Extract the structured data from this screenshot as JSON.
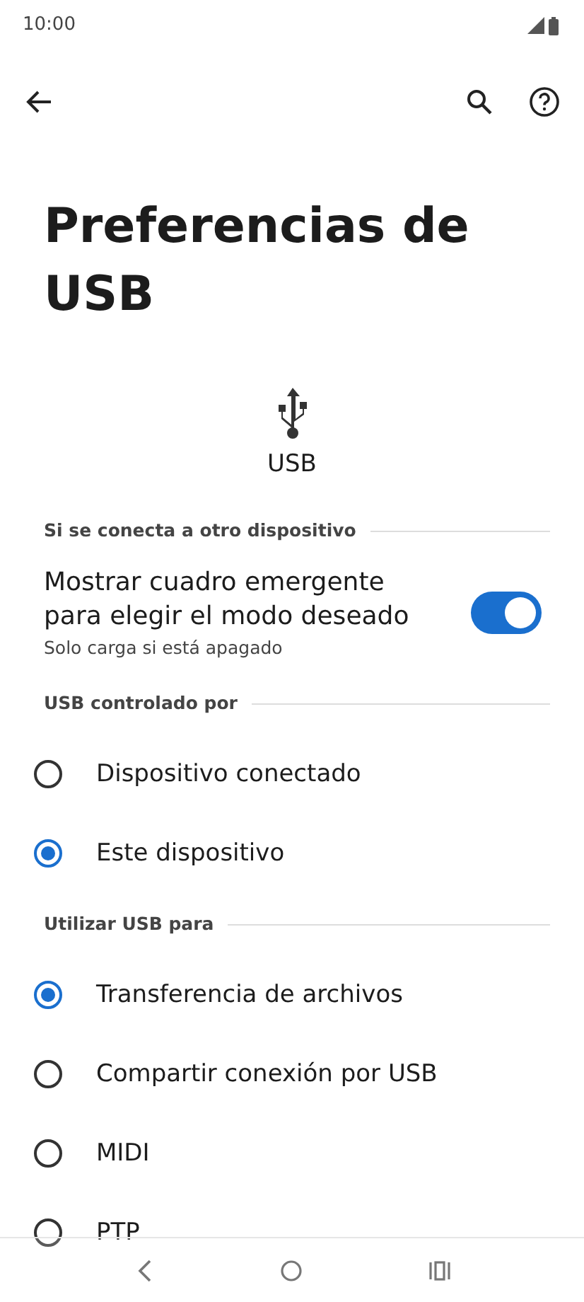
{
  "status_bar": {
    "time": "10:00"
  },
  "title": "Preferencias de USB",
  "device_label": "USB",
  "sections": [
    {
      "header": "Si se conecta a otro dispositivo",
      "items": [
        {
          "kind": "toggle",
          "title": "Mostrar cuadro emergente para elegir el modo deseado",
          "subtitle": "Solo carga si está apagado",
          "on": true
        }
      ]
    },
    {
      "header": "USB controlado por",
      "items": [
        {
          "kind": "radio",
          "label": "Dispositivo conectado",
          "selected": false
        },
        {
          "kind": "radio",
          "label": "Este dispositivo",
          "selected": true
        }
      ]
    },
    {
      "header": "Utilizar USB para",
      "items": [
        {
          "kind": "radio",
          "label": "Transferencia de archivos",
          "selected": true
        },
        {
          "kind": "radio",
          "label": "Compartir conexión por USB",
          "selected": false
        },
        {
          "kind": "radio",
          "label": "MIDI",
          "selected": false
        },
        {
          "kind": "radio",
          "label": "PTP",
          "selected": false
        }
      ]
    }
  ]
}
